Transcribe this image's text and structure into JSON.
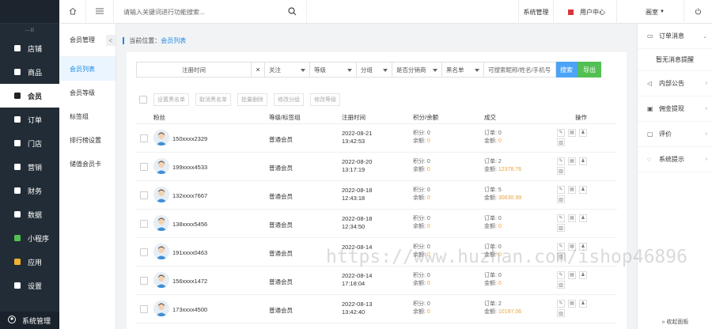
{
  "sidebar": {
    "divider_label": "—B",
    "items": [
      {
        "label": "店铺",
        "icon": "store-icon"
      },
      {
        "label": "商品",
        "icon": "goods-icon"
      },
      {
        "label": "会员",
        "icon": "user-icon"
      },
      {
        "label": "订单",
        "icon": "order-icon"
      },
      {
        "label": "门店",
        "icon": "shop-icon"
      },
      {
        "label": "营销",
        "icon": "marketing-icon"
      },
      {
        "label": "财务",
        "icon": "finance-icon"
      },
      {
        "label": "数据",
        "icon": "data-icon"
      },
      {
        "label": "小程序",
        "icon": "miniapp-icon"
      },
      {
        "label": "应用",
        "icon": "apps-icon"
      },
      {
        "label": "设置",
        "icon": "settings-icon"
      }
    ],
    "bottom_label": "系统管理"
  },
  "topbar": {
    "search_placeholder": "请输入关键词进行功能搜索...",
    "system_manage": "系统管理",
    "user_center": "用户中心",
    "user_name": "画室",
    "colors": {
      "accent": "#1a8ae6",
      "red_icon": "#d9363e"
    }
  },
  "submenu": {
    "title": "会员管理",
    "collapse": "<",
    "items": [
      "会员列表",
      "会员等级",
      "标签组",
      "排行榜设置",
      "储值会员卡"
    ]
  },
  "breadcrumb": {
    "prefix": "当前位置：",
    "current": "会员列表"
  },
  "filters": {
    "register_time": "注册时间",
    "clear": "×",
    "follow": "关注",
    "level": "等级",
    "group": "分组",
    "distribution": "是否分销商",
    "blacklist": "黑名单",
    "keyword_placeholder": "可搜索昵称/姓名/手机号",
    "search_btn": "搜索",
    "export_btn": "导出"
  },
  "bulk_actions": [
    "设置黑名单",
    "取消黑名单",
    "批量删除",
    "修改分组",
    "修改等级"
  ],
  "table": {
    "headers": [
      "粉丝",
      "等级/标签组",
      "注册时间",
      "积分/余额",
      "成交",
      "操作"
    ],
    "points_label": "积分:",
    "balance_label": "余额:",
    "order_label": "订单:",
    "amount_label": "金额:",
    "rows": [
      {
        "name": "150xxxx2329",
        "level": "普通会员",
        "date": "2022-08-21",
        "time": "13:42:53",
        "points": "0",
        "balance": "0",
        "orders": "0",
        "amount": "0"
      },
      {
        "name": "199xxxx4533",
        "level": "普通会员",
        "date": "2022-08-20",
        "time": "13:17:19",
        "points": "0",
        "balance": "0",
        "orders": "2",
        "amount": "12378.76"
      },
      {
        "name": "132xxxx7667",
        "level": "普通会员",
        "date": "2022-08-18",
        "time": "12:43:18",
        "points": "0",
        "balance": "0",
        "orders": "5",
        "amount": "30630.99"
      },
      {
        "name": "138xxxx5456",
        "level": "普通会员",
        "date": "2022-08-18",
        "time": "12:34:50",
        "points": "0",
        "balance": "0",
        "orders": "0",
        "amount": "0"
      },
      {
        "name": "191xxxx0463",
        "level": "普通会员",
        "date": "2022-08-14",
        "time": "",
        "points": "0",
        "balance": "0",
        "orders": "0",
        "amount": "0"
      },
      {
        "name": "156xxxx1472",
        "level": "普通会员",
        "date": "2022-08-14",
        "time": "17:18:04",
        "points": "0",
        "balance": "0",
        "orders": "0",
        "amount": "0"
      },
      {
        "name": "173xxxx4500",
        "level": "普通会员",
        "date": "2022-08-13",
        "time": "13:42:40",
        "points": "0",
        "balance": "0",
        "orders": "2",
        "amount": "10197.06"
      }
    ]
  },
  "right_panel": {
    "order_notice": "订单消息",
    "empty_text": "暂无消息提醒",
    "internal_notice": "内部公告",
    "commission": "佣金提现",
    "comments": "评价",
    "system_tips": "系统提示",
    "collapse_label": "» 收起面板"
  },
  "watermark": "https://www.huzhan.com/ishop46896"
}
